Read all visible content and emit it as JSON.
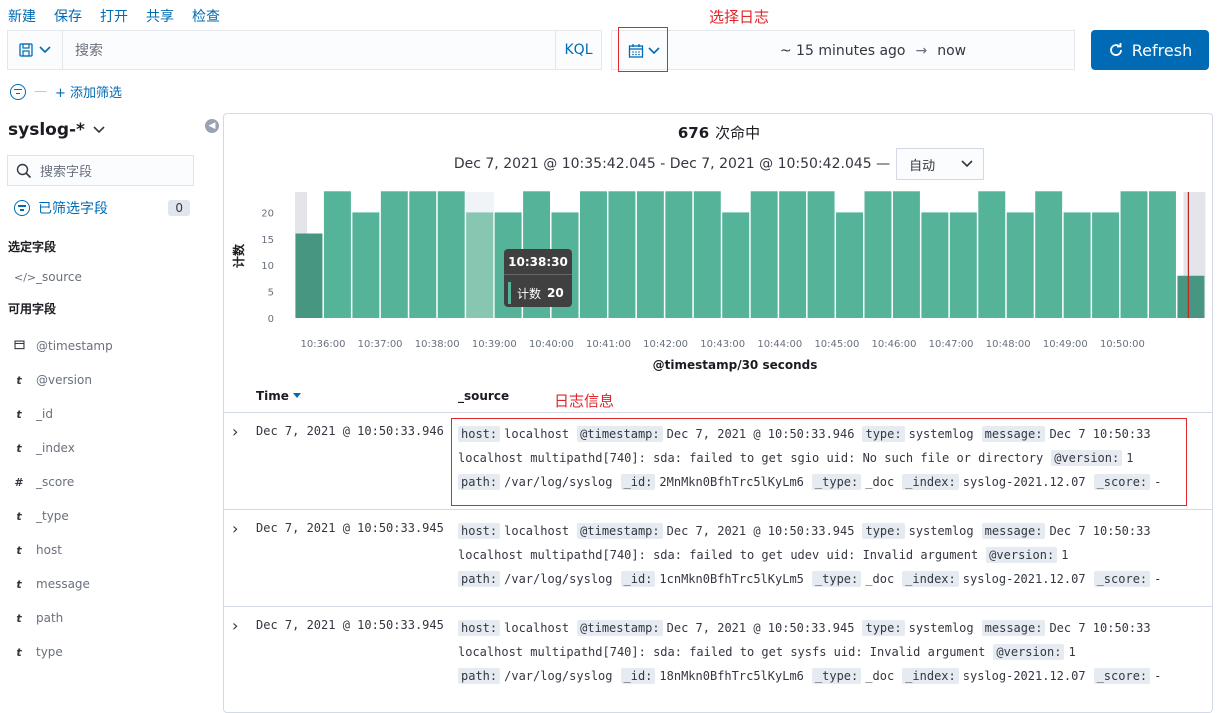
{
  "topmenu": [
    "新建",
    "保存",
    "打开",
    "共享",
    "检查"
  ],
  "annotations": {
    "select_log": "选择日志",
    "log_info": "日志信息"
  },
  "query": {
    "placeholder": "搜索",
    "kql": "KQL"
  },
  "datepicker": {
    "start": "~ 15 minutes ago",
    "arrow": "→",
    "end": "now"
  },
  "refresh": {
    "label": "Refresh"
  },
  "filter": {
    "add": "+ 添加筛选"
  },
  "sidebar": {
    "index_pattern": "syslog-*",
    "search_placeholder": "搜索字段",
    "filtered_label": "已筛选字段",
    "filtered_count": "0",
    "selected_title": "选定字段",
    "selected_fields": [
      {
        "type": "</>",
        "name": "_source"
      }
    ],
    "available_title": "可用字段",
    "available_fields": [
      {
        "type": "date",
        "name": "@timestamp"
      },
      {
        "type": "t",
        "name": "@version"
      },
      {
        "type": "t",
        "name": "_id"
      },
      {
        "type": "t",
        "name": "_index"
      },
      {
        "type": "#",
        "name": "_score"
      },
      {
        "type": "t",
        "name": "_type"
      },
      {
        "type": "t",
        "name": "host"
      },
      {
        "type": "t",
        "name": "message"
      },
      {
        "type": "t",
        "name": "path"
      },
      {
        "type": "t",
        "name": "type"
      }
    ]
  },
  "summary": {
    "hits": "676",
    "hits_label": "次命中",
    "range": "Dec 7, 2021 @ 10:35:42.045 - Dec 7, 2021 @ 10:50:42.045 —",
    "interval": "自动"
  },
  "chart_data": {
    "type": "bar",
    "ylabel": "计数",
    "xlabel": "@timestamp/30 seconds",
    "ylim": [
      0,
      25
    ],
    "yticks": [
      0,
      5,
      10,
      15,
      20
    ],
    "xticks": [
      "10:36:00",
      "10:37:00",
      "10:38:00",
      "10:39:00",
      "10:40:00",
      "10:41:00",
      "10:42:00",
      "10:43:00",
      "10:44:00",
      "10:45:00",
      "10:46:00",
      "10:47:00",
      "10:48:00",
      "10:49:00",
      "10:50:00"
    ],
    "values": [
      16,
      24,
      20,
      24,
      24,
      24,
      20,
      20,
      24,
      20,
      24,
      24,
      24,
      24,
      24,
      20,
      24,
      24,
      24,
      20,
      24,
      24,
      20,
      20,
      24,
      20,
      24,
      20,
      20,
      24,
      24,
      8
    ],
    "highlight_index": 6,
    "color": "#54b399",
    "tooltip": {
      "time": "10:38:30",
      "label": "计数",
      "value": "20"
    }
  },
  "table": {
    "col_time": "Time",
    "col_source": "_source",
    "rows": [
      {
        "time": "Dec 7, 2021 @ 10:50:33.946",
        "line1": [
          [
            "host:",
            "localhost"
          ],
          [
            "@timestamp:",
            "Dec 7, 2021 @ 10:50:33.946"
          ],
          [
            "type:",
            "systemlog"
          ],
          [
            "message:",
            "Dec 7 10:50:33"
          ]
        ],
        "line2_text": "localhost multipathd[740]: sda: failed to get sgio uid: No such file or directory",
        "line2_kv": [
          [
            "@version:",
            "1"
          ]
        ],
        "line3": [
          [
            "path:",
            "/var/log/syslog"
          ],
          [
            "_id:",
            "2MnMkn0BfhTrc5lKyLm6"
          ],
          [
            "_type:",
            "_doc"
          ],
          [
            "_index:",
            "syslog-2021.12.07"
          ],
          [
            "_score:",
            "-"
          ]
        ]
      },
      {
        "time": "Dec 7, 2021 @ 10:50:33.945",
        "line1": [
          [
            "host:",
            "localhost"
          ],
          [
            "@timestamp:",
            "Dec 7, 2021 @ 10:50:33.945"
          ],
          [
            "type:",
            "systemlog"
          ],
          [
            "message:",
            "Dec 7 10:50:33"
          ]
        ],
        "line2_text": "localhost multipathd[740]: sda: failed to get udev uid: Invalid argument",
        "line2_kv": [
          [
            "@version:",
            "1"
          ]
        ],
        "line3": [
          [
            "path:",
            "/var/log/syslog"
          ],
          [
            "_id:",
            "1cnMkn0BfhTrc5lKyLm5"
          ],
          [
            "_type:",
            "_doc"
          ],
          [
            "_index:",
            "syslog-2021.12.07"
          ],
          [
            "_score:",
            "-"
          ]
        ]
      },
      {
        "time": "Dec 7, 2021 @ 10:50:33.945",
        "line1": [
          [
            "host:",
            "localhost"
          ],
          [
            "@timestamp:",
            "Dec 7, 2021 @ 10:50:33.945"
          ],
          [
            "type:",
            "systemlog"
          ],
          [
            "message:",
            "Dec 7 10:50:33"
          ]
        ],
        "line2_text": "localhost multipathd[740]: sda: failed to get sysfs uid: Invalid argument",
        "line2_kv": [
          [
            "@version:",
            "1"
          ]
        ],
        "line3": [
          [
            "path:",
            "/var/log/syslog"
          ],
          [
            "_id:",
            "18nMkn0BfhTrc5lKyLm6"
          ],
          [
            "_type:",
            "_doc"
          ],
          [
            "_index:",
            "syslog-2021.12.07"
          ],
          [
            "_score:",
            "-"
          ]
        ]
      }
    ]
  }
}
